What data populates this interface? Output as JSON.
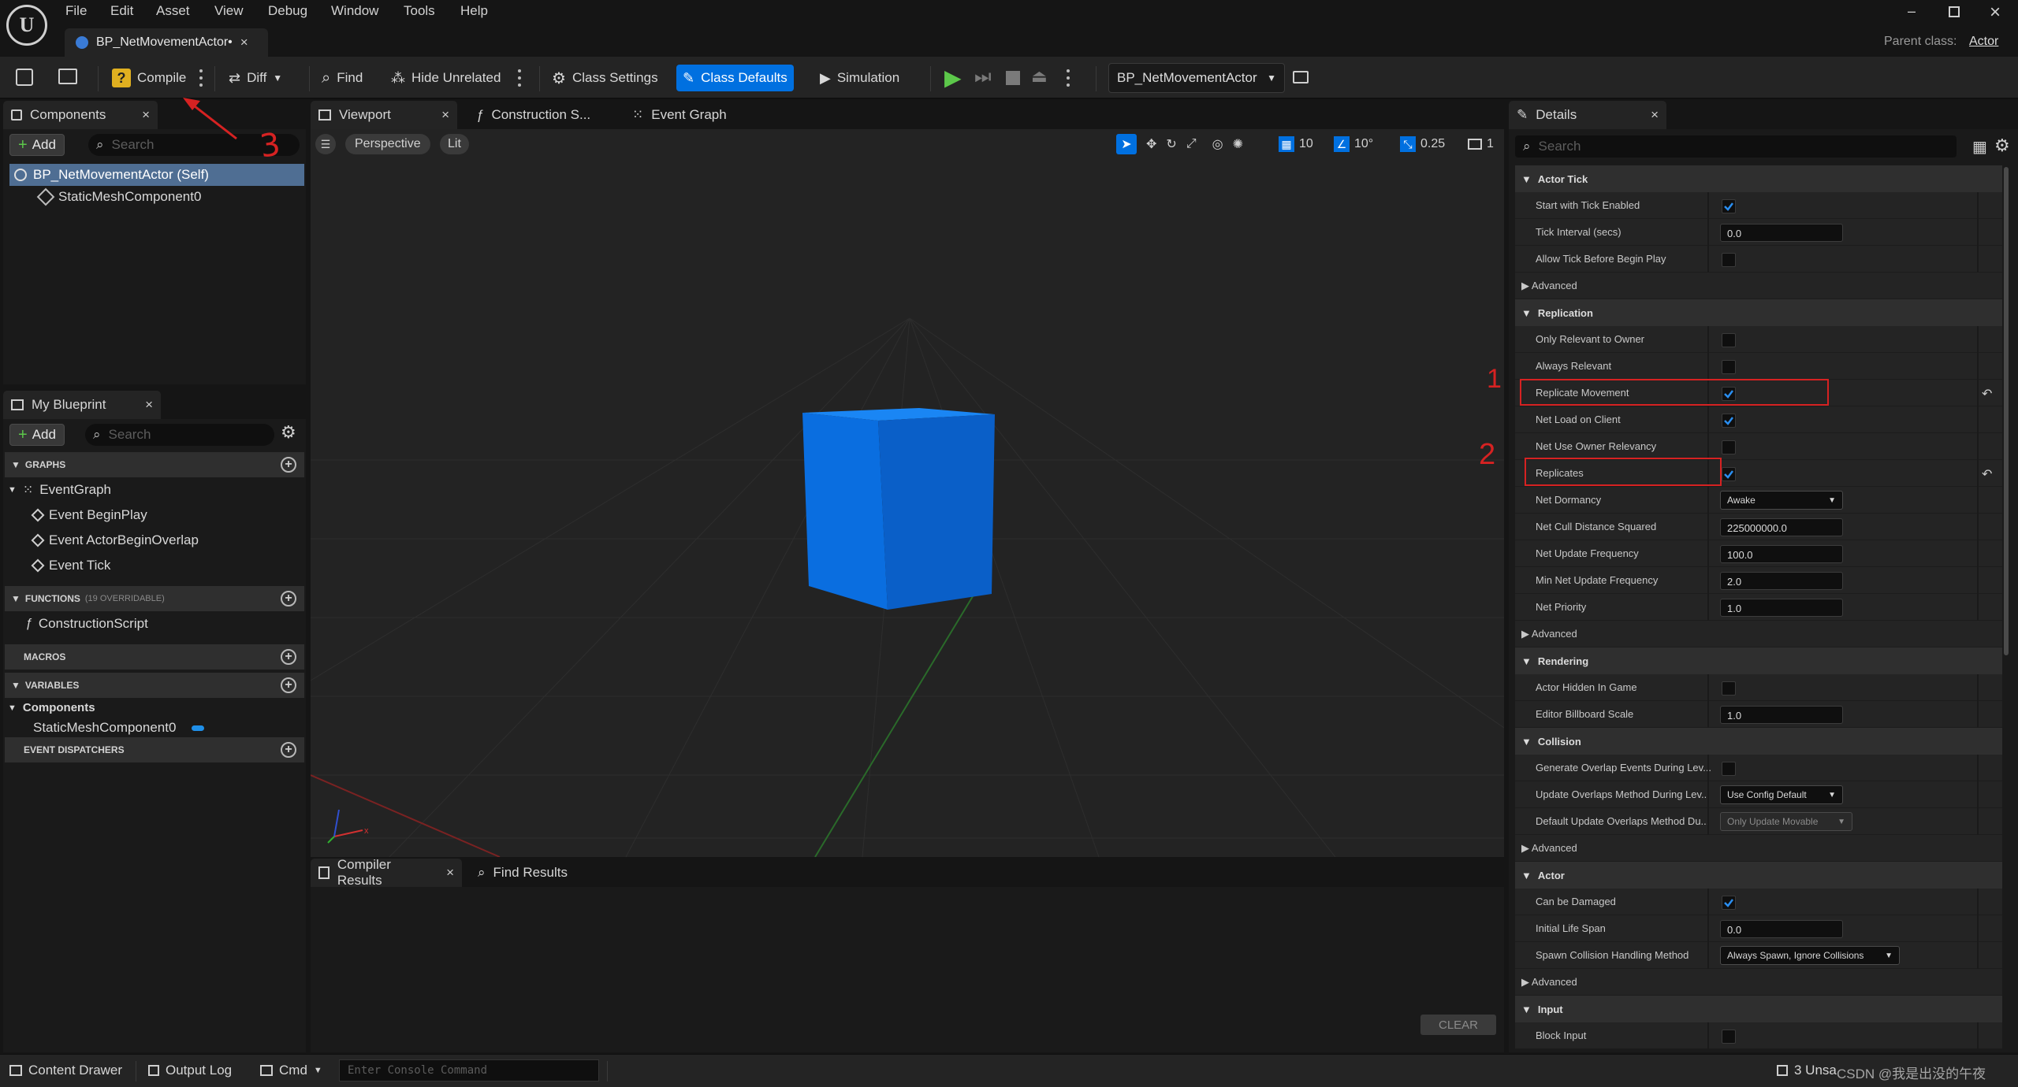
{
  "menu": [
    "File",
    "Edit",
    "Asset",
    "View",
    "Debug",
    "Window",
    "Tools",
    "Help"
  ],
  "document_tab": "BP_NetMovementActor•",
  "parent_class": {
    "label": "Parent class:",
    "value": "Actor"
  },
  "toolbar": {
    "compile": "Compile",
    "diff": "Diff",
    "find": "Find",
    "hide_unrelated": "Hide Unrelated",
    "class_settings": "Class Settings",
    "class_defaults": "Class Defaults",
    "simulation": "Simulation",
    "debug_object": "BP_NetMovementActor"
  },
  "components_panel": {
    "tab": "Components",
    "add": "Add",
    "search_placeholder": "Search",
    "items": [
      "BP_NetMovementActor (Self)",
      "StaticMeshComponent0"
    ]
  },
  "my_blueprint": {
    "tab": "My Blueprint",
    "add": "Add",
    "search_placeholder": "Search",
    "graphs_header": "GRAPHS",
    "event_graph": "EventGraph",
    "events": [
      "Event BeginPlay",
      "Event ActorBeginOverlap",
      "Event Tick"
    ],
    "functions_header": "FUNCTIONS",
    "functions_count": "(19 OVERRIDABLE)",
    "construction_script": "ConstructionScript",
    "macros_header": "MACROS",
    "variables_header": "VARIABLES",
    "components_group": "Components",
    "variable_item": "StaticMeshComponent0",
    "dispatchers_header": "EVENT DISPATCHERS"
  },
  "center_tabs": [
    "Viewport",
    "Construction S...",
    "Event Graph"
  ],
  "viewport": {
    "perspective": "Perspective",
    "lit": "Lit",
    "grid_snap": "10",
    "rotation_snap": "10°",
    "scale_snap": "0.25",
    "camera_speed": "1"
  },
  "bottom_tabs": {
    "compiler_results": "Compiler Results",
    "find_results": "Find Results",
    "clear": "CLEAR"
  },
  "details": {
    "tab": "Details",
    "search_placeholder": "Search",
    "actor_tick": {
      "header": "Actor Tick",
      "start_with_tick": "Start with Tick Enabled",
      "tick_interval": "Tick Interval (secs)",
      "tick_interval_value": "0.0",
      "allow_tick": "Allow Tick Before Begin Play",
      "advanced": "Advanced"
    },
    "replication": {
      "header": "Replication",
      "only_relevant": "Only Relevant to Owner",
      "always_relevant": "Always Relevant",
      "replicate_movement": "Replicate Movement",
      "net_load": "Net Load on Client",
      "net_use_owner": "Net Use Owner Relevancy",
      "replicates": "Replicates",
      "net_dormancy": "Net Dormancy",
      "net_dormancy_value": "Awake",
      "net_cull": "Net Cull Distance Squared",
      "net_cull_value": "225000000.0",
      "net_update": "Net Update Frequency",
      "net_update_value": "100.0",
      "min_net_update": "Min Net Update Frequency",
      "min_net_update_value": "2.0",
      "net_priority": "Net Priority",
      "net_priority_value": "1.0",
      "advanced": "Advanced"
    },
    "rendering": {
      "header": "Rendering",
      "hidden": "Actor Hidden In Game",
      "billboard": "Editor Billboard Scale",
      "billboard_value": "1.0"
    },
    "collision": {
      "header": "Collision",
      "gen_overlap": "Generate Overlap Events During Lev...",
      "update_overlaps": "Update Overlaps Method During Lev...",
      "update_overlaps_value": "Use Config Default",
      "default_update": "Default Update Overlaps Method Du...",
      "default_update_value": "Only Update Movable",
      "advanced": "Advanced"
    },
    "actor": {
      "header": "Actor",
      "can_be_damaged": "Can be Damaged",
      "life_span": "Initial Life Span",
      "life_span_value": "0.0",
      "spawn_collision": "Spawn Collision Handling Method",
      "spawn_collision_value": "Always Spawn, Ignore Collisions",
      "advanced": "Advanced"
    },
    "input": {
      "header": "Input",
      "block_input": "Block Input"
    }
  },
  "statusbar": {
    "content_drawer": "Content Drawer",
    "output_log": "Output Log",
    "cmd": "Cmd",
    "console_placeholder": "Enter Console Command",
    "unsaved": "3 Unsa",
    "watermark": "CSDN @我是出没的午夜"
  },
  "annotations": {
    "mark1": "1",
    "mark2": "2",
    "mark3": "3"
  },
  "colors": {
    "accent": "#0070e0",
    "annotation_red": "#d62222",
    "cube": "#0a6ee0",
    "background": "#151515",
    "panel": "#242424"
  }
}
